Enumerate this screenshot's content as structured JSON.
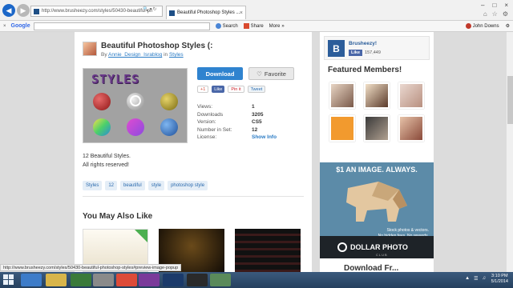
{
  "browser": {
    "url": "http://www.brusheezy.com/styles/50430-beautiful-ph",
    "tab_title": "Beautiful Photoshop Styles ...",
    "toolbar": {
      "google": "Google",
      "search": "Search",
      "share": "Share",
      "more": "More",
      "user": "John Downs"
    },
    "status_url": "http://www.brusheezy.com/styles/50430-beautiful-photoshop-styles#preview-image-popup"
  },
  "item": {
    "title": "Beautiful Photoshop Styles (:",
    "by_label": "By",
    "author": "Annie_Design_Israblog",
    "in_label": "in",
    "category": "Styles",
    "preview_word": "STYLES",
    "download_label": "Download",
    "favorite_label": "Favorite",
    "social": {
      "gplus": "+1",
      "fb_like": "Like",
      "pin": "Pin it",
      "tweet": "Tweet"
    },
    "meta": [
      {
        "k": "Views:",
        "v": "1"
      },
      {
        "k": "Downloads",
        "v": "3205"
      },
      {
        "k": "Version:",
        "v": "CS5"
      },
      {
        "k": "Number in Set:",
        "v": "12"
      },
      {
        "k": "License:",
        "v": "Show Info"
      }
    ],
    "description_1": "12 Beautiful Styles.",
    "description_2": "All rights reserved!",
    "tags": [
      "Styles",
      "12",
      "beautiful",
      "style",
      "photoshop style"
    ],
    "also_like_title": "You May Also Like"
  },
  "sidebar": {
    "fb_name": "Brusheezy!",
    "fb_like": "Like",
    "fb_count": "157,449",
    "featured_title": "Featured Members!",
    "ad_headline": "$1 AN IMAGE. ALWAYS.",
    "ad_line1": "Stock photos & vectors.",
    "ad_line2": "No hidden fees. No rewards.",
    "ad_brand": "DOLLAR PHOTO",
    "ad_club": "CLUB",
    "partial_heading": "Download Fr..."
  },
  "taskbar": {
    "time": "3:10 PM",
    "date": "5/1/2014"
  },
  "colors": {
    "accent": "#2f83cf",
    "link": "#2a7bc5",
    "facebook": "#2c5d9a"
  }
}
